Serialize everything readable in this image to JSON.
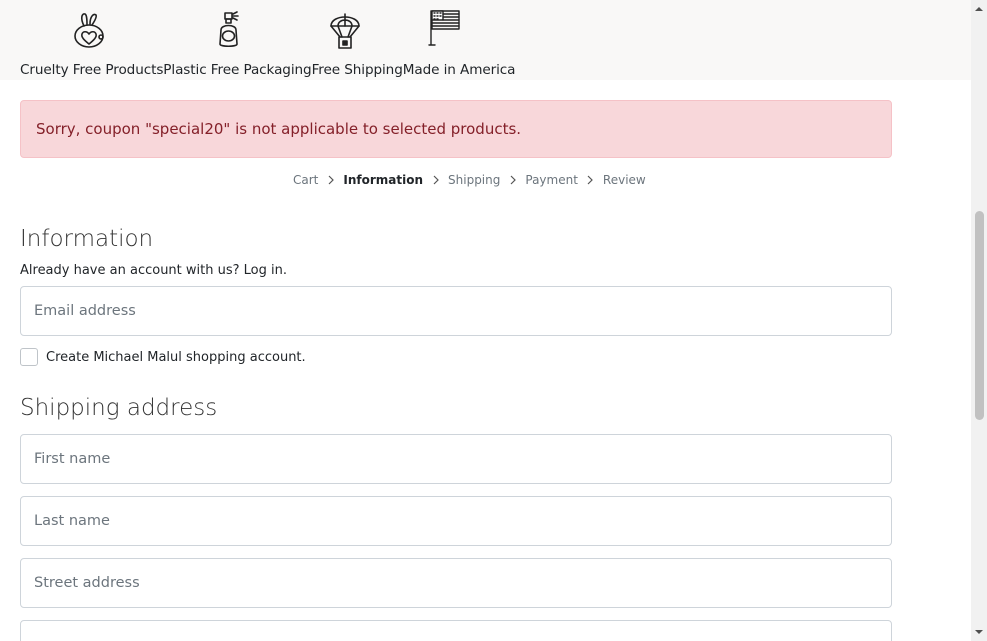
{
  "features": {
    "items": [
      {
        "label": "Cruelty Free Products",
        "icon": "rabbit-heart-icon"
      },
      {
        "label": "Plastic Free Packaging",
        "icon": "perfume-bottle-icon"
      },
      {
        "label": "Free Shipping",
        "icon": "parachute-box-icon"
      },
      {
        "label": "Made in America",
        "icon": "us-flag-icon"
      }
    ]
  },
  "alert": {
    "message": "Sorry, coupon \"special20\" is not applicable to selected products."
  },
  "breadcrumb": {
    "steps": [
      "Cart",
      "Information",
      "Shipping",
      "Payment",
      "Review"
    ],
    "active": "Information"
  },
  "information": {
    "title": "Information",
    "login_prompt": "Already have an account with us?",
    "login_link": "Log in."
  },
  "email_field": {
    "placeholder": "Email address",
    "value": ""
  },
  "create_account": {
    "label": "Create Michael Malul shopping account.",
    "checked": false
  },
  "shipping": {
    "title": "Shipping address",
    "first_name_placeholder": "First name",
    "last_name_placeholder": "Last name",
    "street_placeholder": "Street address"
  },
  "colors": {
    "alert_bg": "#f8d7da",
    "alert_text": "#842029",
    "features_bg": "#f9f8f7"
  }
}
